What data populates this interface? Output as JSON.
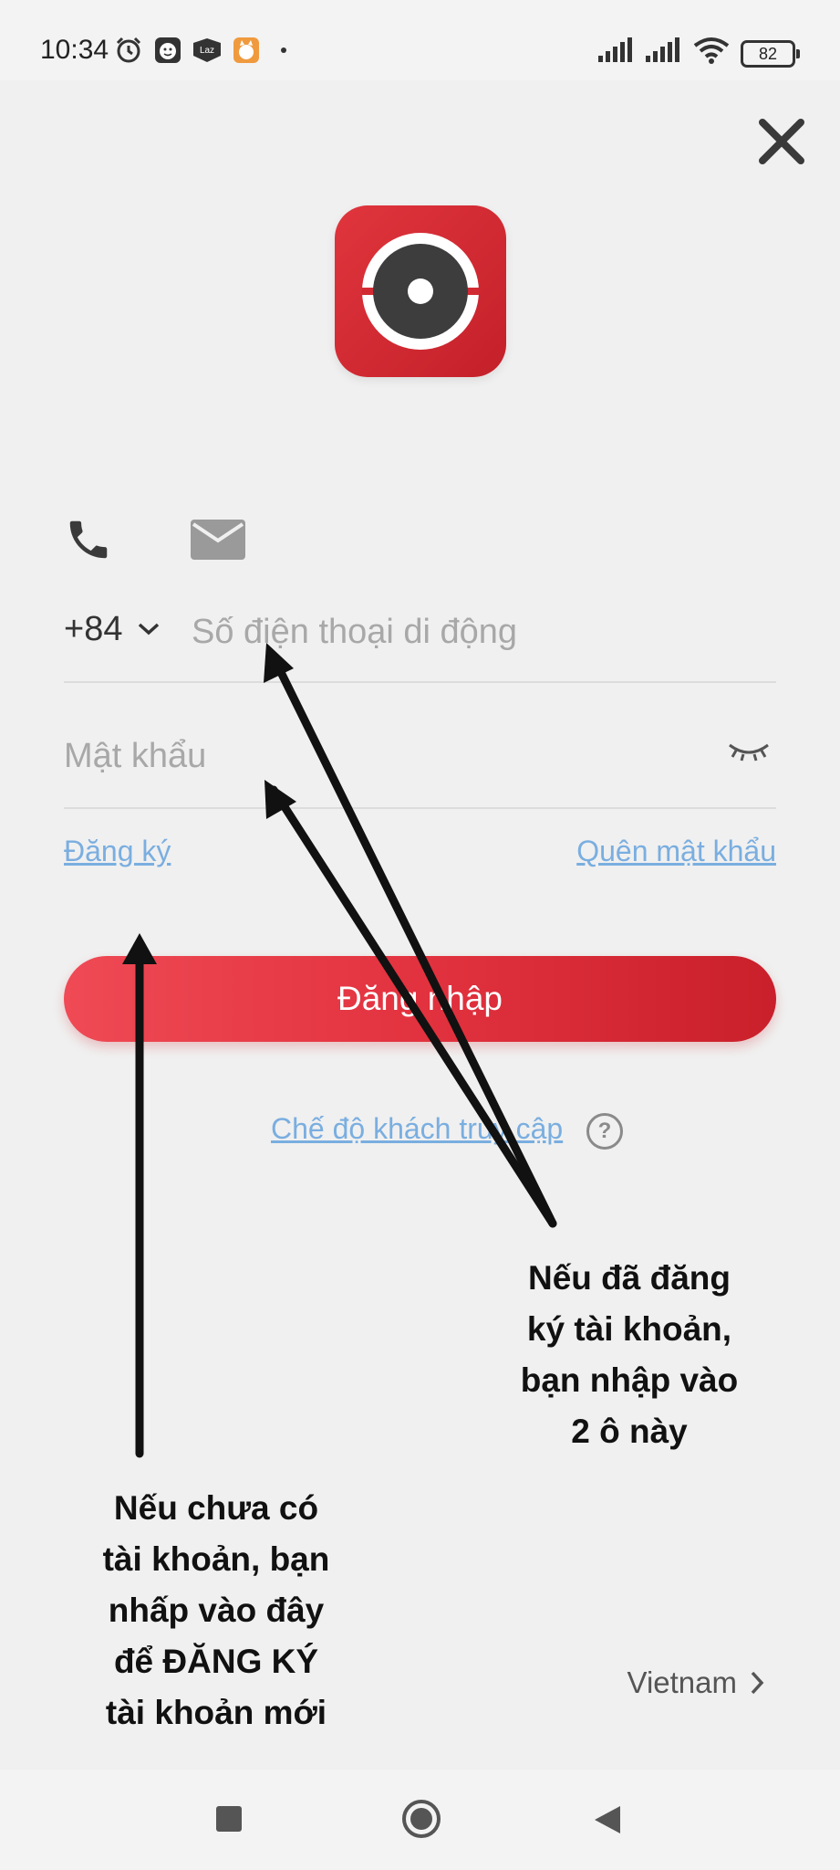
{
  "status_bar": {
    "time": "10:34",
    "battery": "82",
    "icons": [
      "alarm-icon",
      "face-app-icon",
      "laz-app-icon",
      "cat-app-icon",
      "dot-icon",
      "signal-icon",
      "signal-icon",
      "wifi-icon",
      "battery-icon"
    ],
    "laz_label": "Laz"
  },
  "login": {
    "tabs": [
      "phone-icon",
      "email-icon"
    ],
    "country_code": "+84",
    "phone_placeholder": "Số điện thoại di động",
    "password_placeholder": "Mật khẩu",
    "register_link": "Đăng ký",
    "forgot_link": "Quên mật khẩu",
    "login_button": "Đăng nhập",
    "guest_link": "Chế độ khách truy cập",
    "help": "?",
    "region": "Vietnam"
  },
  "annotations": {
    "right": [
      "Nếu đã đăng",
      "ký tài khoản,",
      "bạn nhập vào",
      "2 ô này"
    ],
    "left": [
      "Nếu chưa có",
      "tài khoản, bạn",
      "nhấp vào đây",
      "để ĐĂNG KÝ",
      "tài khoản mới"
    ]
  },
  "colors": {
    "brand_red": "#e0353d",
    "link_blue": "#7aaee0",
    "background": "#f0f0f0"
  }
}
